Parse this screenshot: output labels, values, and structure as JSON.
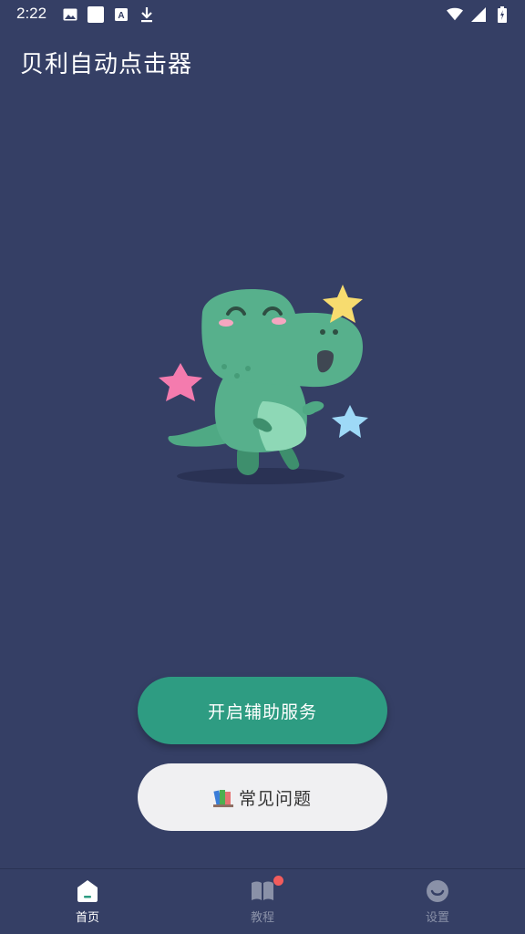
{
  "status_bar": {
    "time": "2:22",
    "left_icons": [
      "image-icon",
      "white-square-icon",
      "font-a-icon",
      "download-icon"
    ],
    "right_icons": [
      "wifi-icon",
      "cell-signal-icon",
      "battery-charging-icon"
    ]
  },
  "app": {
    "title": "贝利自动点击器"
  },
  "illustration": {
    "name": "dinosaur-mascot-illustration"
  },
  "buttons": {
    "primary_label": "开启辅助服务",
    "secondary_label": "常见问题",
    "secondary_icon": "books-icon"
  },
  "bottom_nav": {
    "items": [
      {
        "label": "首页",
        "icon": "home-icon",
        "active": true
      },
      {
        "label": "教程",
        "icon": "book-icon",
        "active": false,
        "badge": true
      },
      {
        "label": "设置",
        "icon": "smile-icon",
        "active": false
      }
    ]
  },
  "colors": {
    "background": "#353F65",
    "primary_button": "#2E9C82",
    "secondary_button": "#F0F0F2",
    "badge": "#F25C5C",
    "inactive_nav": "#8A91A8"
  }
}
